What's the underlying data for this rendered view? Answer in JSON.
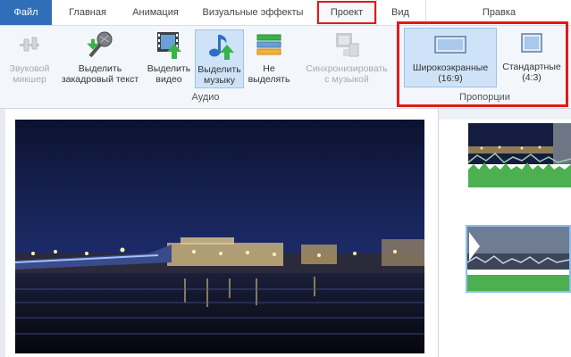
{
  "tabs": {
    "file": "Файл",
    "home": "Главная",
    "animation": "Анимация",
    "visual_effects": "Визуальные эффекты",
    "project": "Проект",
    "view": "Вид",
    "edit": "Правка"
  },
  "audio_group": {
    "label": "Аудио",
    "buttons": [
      {
        "line1": "Звуковой",
        "line2": "микшер",
        "icon": "mixer-icon",
        "enabled": false
      },
      {
        "line1": "Выделить",
        "line2": "закадровый текст",
        "icon": "microphone-icon",
        "enabled": true
      },
      {
        "line1": "Выделить",
        "line2": "видео",
        "icon": "film-icon",
        "enabled": true
      },
      {
        "line1": "Выделить",
        "line2": "музыку",
        "icon": "music-note-icon",
        "enabled": true,
        "selected": true
      },
      {
        "line1": "Не",
        "line2": "выделять",
        "icon": "equal-bars-icon",
        "enabled": true
      },
      {
        "line1": "Синхронизировать",
        "line2": "с музыкой",
        "icon": "sync-icon",
        "enabled": false
      }
    ]
  },
  "aspect_group": {
    "label": "Пропорции",
    "widescreen": {
      "line1": "Широкоэкранные",
      "line2": "(16:9)",
      "icon": "widescreen-icon",
      "selected": true
    },
    "standard": {
      "line1": "Стандартные",
      "line2": "(4:3)",
      "icon": "standard-screen-icon",
      "selected": false
    }
  },
  "colors": {
    "file_tab": "#2f6fba",
    "highlight_box": "#e11a1a",
    "selected_button": "#cfe3f8",
    "audio_waveform": "#4caf50"
  }
}
